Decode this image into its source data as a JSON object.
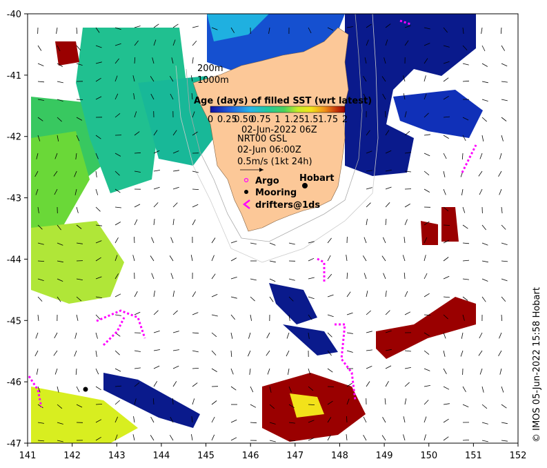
{
  "map": {
    "lon_ticks": [
      "141",
      "142",
      "143",
      "144",
      "145",
      "146",
      "147",
      "148",
      "149",
      "150",
      "151",
      "152"
    ],
    "lat_ticks": [
      "-40",
      "-41",
      "-42",
      "-43",
      "-44",
      "-45",
      "-46",
      "-47"
    ],
    "bathymetry": [
      "200m",
      "1000m"
    ],
    "colorbar": {
      "title": "Age (days) of filled SST (wrt latest)",
      "labels": [
        "0",
        "0.25",
        "0.50",
        "0.75",
        "1",
        "1.25",
        "1.5",
        "1.75",
        "2"
      ],
      "colors": [
        "#1a1aa8",
        "#1f6fe0",
        "#27b6e8",
        "#2ac9a0",
        "#4cd15a",
        "#b8e830",
        "#f3e41a",
        "#f0a31a",
        "#c83c0a",
        "#990000"
      ]
    },
    "sst_date": "02-Jun-2022 06Z",
    "current_source": "NRT00 GSL",
    "current_time": "02-Jun 06:00Z",
    "scale_label": "0.5m/s (1kt 24h)",
    "legend": {
      "argo": "Argo",
      "mooring": "Mooring",
      "drifters": "drifters@1ds"
    },
    "place": "Hobart",
    "credit": "© IMOS 05-Jun-2022 15:58 Hobart",
    "colors": {
      "land": "#fcc898",
      "argo": "#ff00ff",
      "drifter": "#ff00ff",
      "mooring": "#000000"
    }
  }
}
